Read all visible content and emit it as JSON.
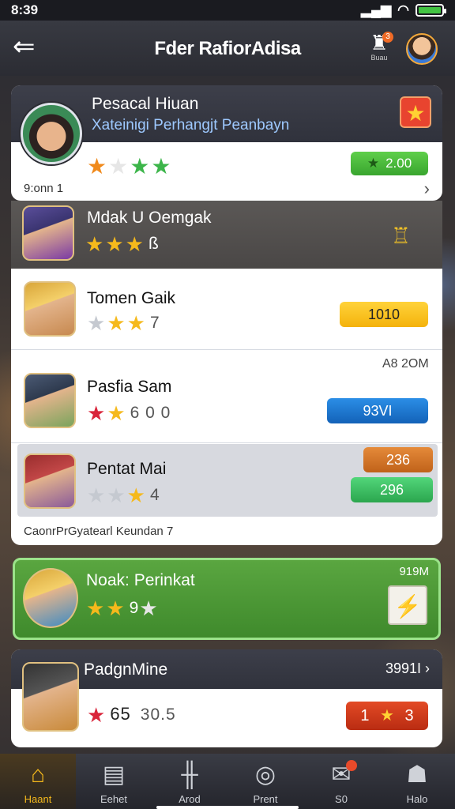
{
  "status_bar": {
    "time": "8:39"
  },
  "header": {
    "title": "Fder RafiorAdisa",
    "notif_count": "3",
    "notif_label": "Buau"
  },
  "profile": {
    "name": "Pesacal Hiuan",
    "subtitle": "Xateinigi Perhangjt Peanbayn",
    "value": "2.00",
    "footer": "9:onn 1"
  },
  "rows": {
    "row0": {
      "name": "Mdak U Oemgak",
      "stars_num": "ß"
    },
    "row1": {
      "name": "Tomen Gaik",
      "stars_num": "7",
      "pill": "1010"
    },
    "row1_side": "A8 2OM",
    "row2": {
      "name": "Pasfia Sam",
      "stars_num": "6 0 0",
      "pill": "93VI"
    },
    "row3": {
      "name": "Pentat Mai",
      "stars_num": "4",
      "pill_a": "236",
      "pill_b": "296"
    },
    "list_footer": "CaonrPrGyatearl Keundan 7"
  },
  "selected": {
    "name": "Noak: Perinkat",
    "stars_num": "9",
    "corner": "919M"
  },
  "bottom": {
    "name": "PadgnMine",
    "corner": "3991I",
    "score_a": "65",
    "score_b": "30.5",
    "pill_left": "1",
    "pill_right": "3"
  },
  "nav": [
    {
      "label": "Haant",
      "icon": "home-icon"
    },
    {
      "label": "Eehet",
      "icon": "shop-icon"
    },
    {
      "label": "Arod",
      "icon": "tools-icon"
    },
    {
      "label": "Prent",
      "icon": "target-icon"
    },
    {
      "label": "S0",
      "icon": "chat-icon"
    },
    {
      "label": "Halo",
      "icon": "user-icon"
    }
  ]
}
